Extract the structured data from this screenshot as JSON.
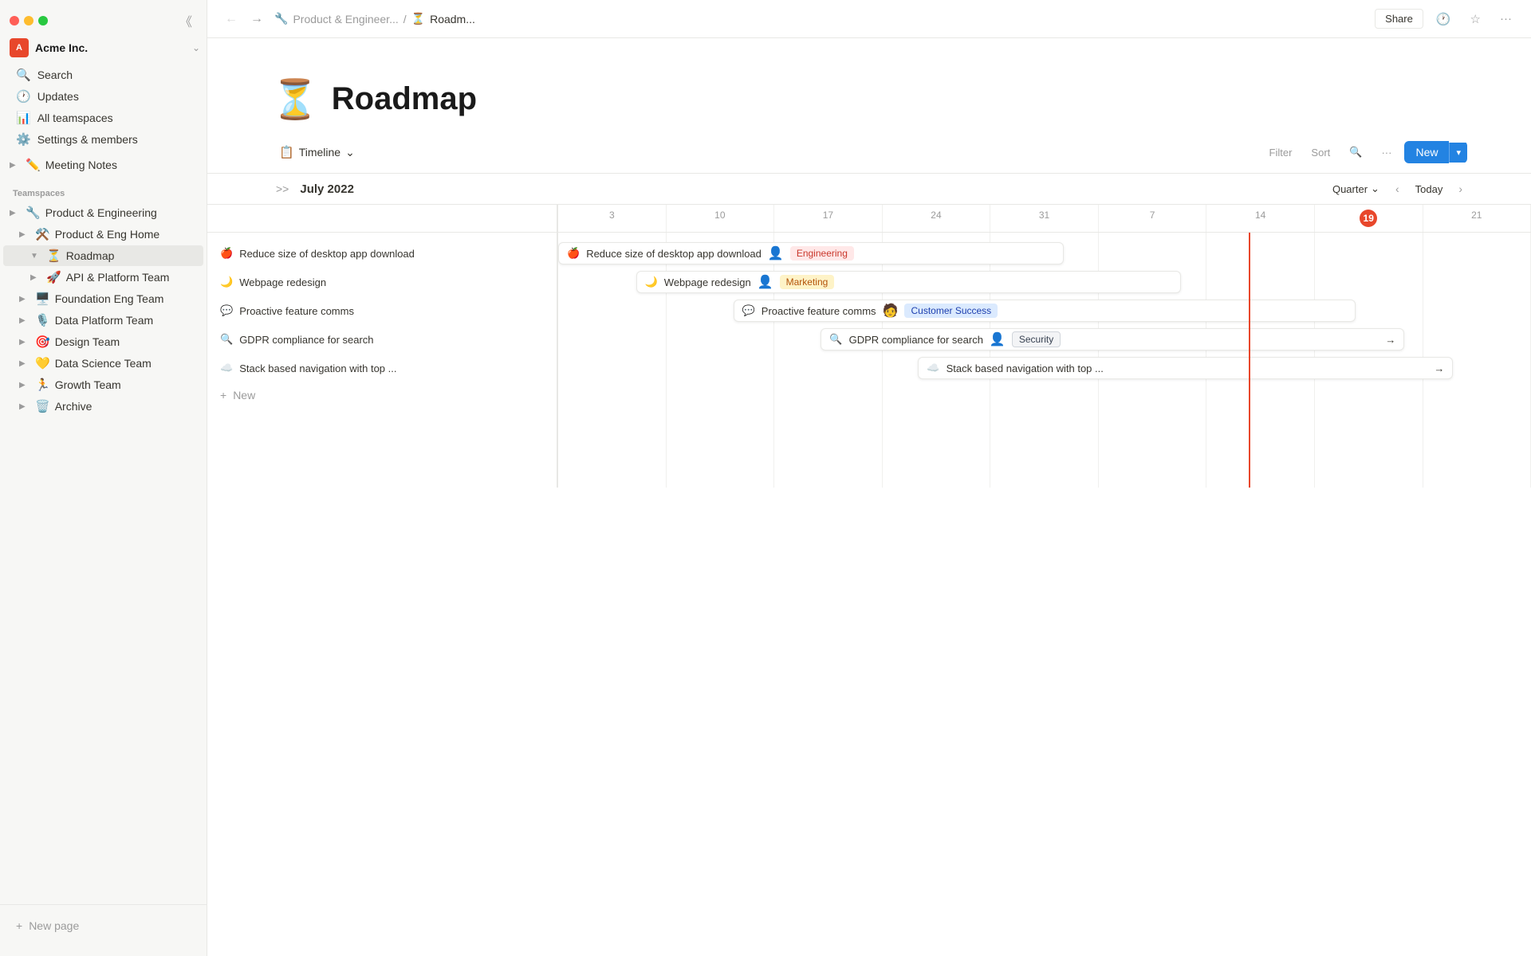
{
  "window": {
    "title": "Roadmap"
  },
  "sidebar": {
    "workspace_name": "Acme Inc.",
    "workspace_icon": "A",
    "nav_items": [
      {
        "id": "search",
        "icon": "🔍",
        "label": "Search"
      },
      {
        "id": "updates",
        "icon": "🕐",
        "label": "Updates"
      },
      {
        "id": "all-teamspaces",
        "icon": "📊",
        "label": "All teamspaces"
      },
      {
        "id": "settings",
        "icon": "⚙️",
        "label": "Settings & members"
      }
    ],
    "pinned_items": [
      {
        "id": "meeting-notes",
        "icon": "✏️",
        "label": "Meeting Notes",
        "indent": 0
      }
    ],
    "teamspaces_label": "Teamspaces",
    "tree_items": [
      {
        "id": "product-eng",
        "icon": "🔧",
        "label": "Product & Engineering",
        "indent": 0,
        "expanded": false
      },
      {
        "id": "product-eng-home",
        "icon": "⚒️",
        "label": "Product & Eng Home",
        "indent": 1,
        "expanded": false
      },
      {
        "id": "roadmap",
        "icon": "⏳",
        "label": "Roadmap",
        "indent": 2,
        "active": true,
        "expanded": true
      },
      {
        "id": "api-platform",
        "icon": "🚀",
        "label": "API & Platform Team",
        "indent": 2,
        "expanded": false
      },
      {
        "id": "foundation-eng",
        "icon": "🖥️",
        "label": "Foundation Eng Team",
        "indent": 1,
        "expanded": false
      },
      {
        "id": "data-platform",
        "icon": "🎙️",
        "label": "Data Platform Team",
        "indent": 1,
        "expanded": false
      },
      {
        "id": "design-team",
        "icon": "🎯",
        "label": "Design Team",
        "indent": 1,
        "expanded": false
      },
      {
        "id": "data-science",
        "icon": "💛",
        "label": "Data Science Team",
        "indent": 1,
        "expanded": false
      },
      {
        "id": "growth-team",
        "icon": "🏃",
        "label": "Growth Team",
        "indent": 1,
        "expanded": false
      },
      {
        "id": "archive",
        "icon": "🗑️",
        "label": "Archive",
        "indent": 1,
        "expanded": false
      }
    ],
    "new_page_label": "New page"
  },
  "topbar": {
    "breadcrumb_parent_icon": "🔧",
    "breadcrumb_parent": "Product & Engineer...",
    "breadcrumb_sep": "/",
    "breadcrumb_current_icon": "⏳",
    "breadcrumb_current": "Roadm...",
    "share_label": "Share"
  },
  "page": {
    "emoji": "⏳",
    "title": "Roadmap"
  },
  "toolbar": {
    "view_icon": "📋",
    "view_label": "Timeline",
    "filter_label": "Filter",
    "sort_label": "Sort",
    "new_label": "New"
  },
  "timeline": {
    "skip_icon": ">>",
    "month": "July 2022",
    "quarter_label": "Quarter",
    "today_label": "Today",
    "dates": [
      "3",
      "10",
      "17",
      "24",
      "31",
      "7",
      "14",
      "19",
      "21"
    ],
    "today_date": "19",
    "tasks": [
      {
        "id": "task1",
        "emoji": "🍎",
        "label": "Reduce size of desktop app download",
        "tag": "Engineering",
        "tag_class": "tag-engineering",
        "avatar": "👤",
        "bar_left": "0%",
        "bar_width": "50%"
      },
      {
        "id": "task2",
        "emoji": "🌙",
        "label": "Webpage redesign",
        "tag": "Marketing",
        "tag_class": "tag-marketing",
        "avatar": "👤",
        "bar_left": "8%",
        "bar_width": "55%"
      },
      {
        "id": "task3",
        "emoji": "💬",
        "label": "Proactive feature comms",
        "tag": "Customer Success",
        "tag_class": "tag-customer-success",
        "avatar": "👤",
        "bar_left": "18%",
        "bar_width": "68%"
      },
      {
        "id": "task4",
        "emoji": "🔍",
        "label": "GDPR compliance for search",
        "tag": "Security",
        "tag_class": "tag-security",
        "avatar": "👤",
        "bar_left": "27%",
        "bar_width": "55%",
        "has_arrow": true
      },
      {
        "id": "task5",
        "emoji": "☁️",
        "label": "Stack based navigation with top ...",
        "tag": "",
        "bar_left": "37%",
        "bar_width": "45%",
        "has_arrow": true
      }
    ],
    "new_label": "+ New"
  }
}
